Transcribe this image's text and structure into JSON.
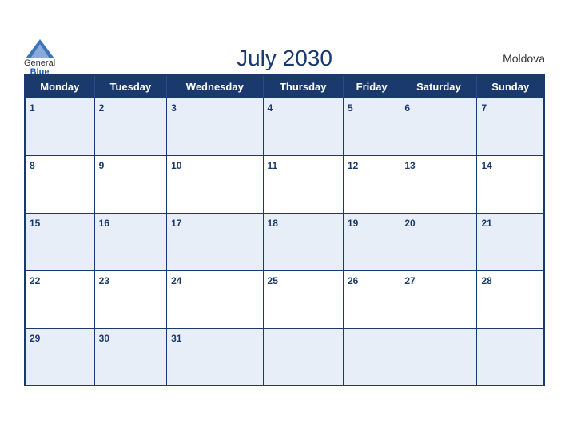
{
  "header": {
    "title": "July 2030",
    "country": "Moldova",
    "logo_general": "General",
    "logo_blue": "Blue"
  },
  "weekdays": [
    "Monday",
    "Tuesday",
    "Wednesday",
    "Thursday",
    "Friday",
    "Saturday",
    "Sunday"
  ],
  "weeks": [
    [
      {
        "day": "1",
        "empty": false
      },
      {
        "day": "2",
        "empty": false
      },
      {
        "day": "3",
        "empty": false
      },
      {
        "day": "4",
        "empty": false
      },
      {
        "day": "5",
        "empty": false
      },
      {
        "day": "6",
        "empty": false
      },
      {
        "day": "7",
        "empty": false
      }
    ],
    [
      {
        "day": "8",
        "empty": false
      },
      {
        "day": "9",
        "empty": false
      },
      {
        "day": "10",
        "empty": false
      },
      {
        "day": "11",
        "empty": false
      },
      {
        "day": "12",
        "empty": false
      },
      {
        "day": "13",
        "empty": false
      },
      {
        "day": "14",
        "empty": false
      }
    ],
    [
      {
        "day": "15",
        "empty": false
      },
      {
        "day": "16",
        "empty": false
      },
      {
        "day": "17",
        "empty": false
      },
      {
        "day": "18",
        "empty": false
      },
      {
        "day": "19",
        "empty": false
      },
      {
        "day": "20",
        "empty": false
      },
      {
        "day": "21",
        "empty": false
      }
    ],
    [
      {
        "day": "22",
        "empty": false
      },
      {
        "day": "23",
        "empty": false
      },
      {
        "day": "24",
        "empty": false
      },
      {
        "day": "25",
        "empty": false
      },
      {
        "day": "26",
        "empty": false
      },
      {
        "day": "27",
        "empty": false
      },
      {
        "day": "28",
        "empty": false
      }
    ],
    [
      {
        "day": "29",
        "empty": false
      },
      {
        "day": "30",
        "empty": false
      },
      {
        "day": "31",
        "empty": false
      },
      {
        "day": "",
        "empty": true
      },
      {
        "day": "",
        "empty": true
      },
      {
        "day": "",
        "empty": true
      },
      {
        "day": "",
        "empty": true
      }
    ]
  ]
}
